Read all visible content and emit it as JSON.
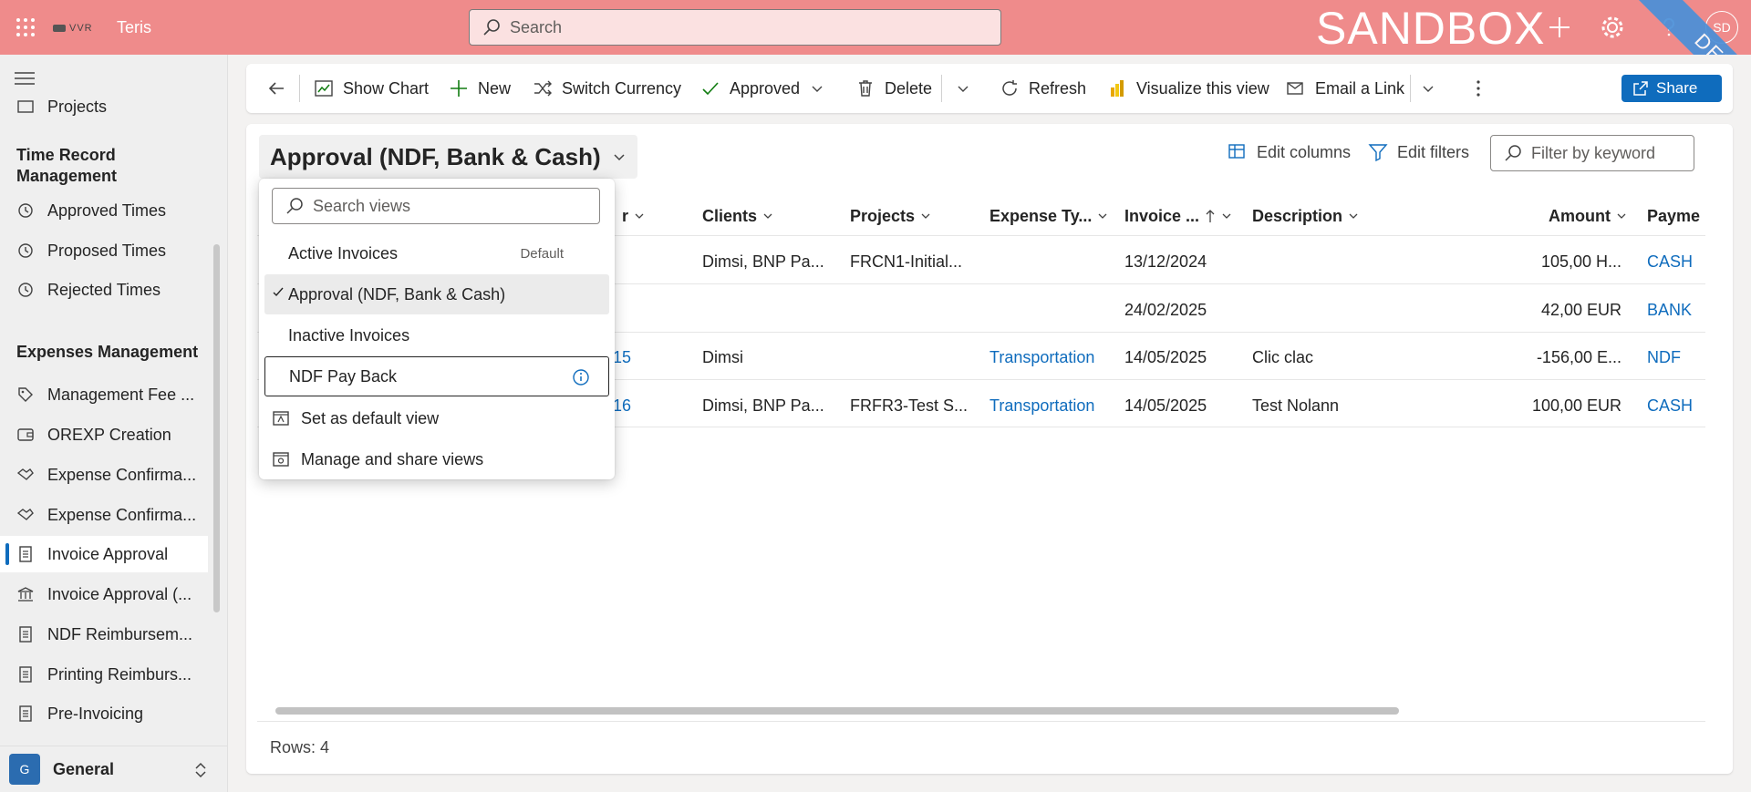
{
  "topbar": {
    "logo_text": "VVR",
    "app_name": "Teris",
    "search_placeholder": "Search",
    "env_label": "SANDBOX",
    "ribbon_label": "DEV",
    "user_initials": "SD"
  },
  "sidebar": {
    "top_item": "Projects",
    "group_time": "Time Record Management",
    "time_items": [
      "Approved Times",
      "Proposed Times",
      "Rejected Times"
    ],
    "group_expenses": "Expenses Management",
    "expense_items": [
      "Management Fee ...",
      "OREXP Creation",
      "Expense Confirma...",
      "Expense Confirma...",
      "Invoice Approval",
      "Invoice Approval (...",
      "NDF Reimbursem...",
      "Printing Reimburs...",
      "Pre-Invoicing"
    ],
    "area_badge": "G",
    "area_label": "General"
  },
  "commands": {
    "show_chart": "Show Chart",
    "new": "New",
    "switch_currency": "Switch Currency",
    "approved": "Approved",
    "delete": "Delete",
    "refresh": "Refresh",
    "visualize": "Visualize this view",
    "email_link": "Email a Link",
    "share": "Share"
  },
  "view": {
    "title": "Approval (NDF, Bank & Cash)",
    "edit_columns": "Edit columns",
    "edit_filters": "Edit filters",
    "filter_placeholder": "Filter by keyword"
  },
  "grid": {
    "columns": [
      "r",
      "Clients",
      "Projects",
      "Expense Ty...",
      "Invoice ...",
      "Description",
      "Amount",
      "Payme"
    ],
    "rows": [
      {
        "id": "",
        "client": "Dimsi, BNP Pa...",
        "project": "FRCN1-Initial...",
        "type": "",
        "date": "13/12/2024",
        "desc": "",
        "amount": "105,00 H...",
        "pay": "CASH"
      },
      {
        "id": "",
        "client": "",
        "project": "",
        "type": "",
        "date": "24/02/2025",
        "desc": "",
        "amount": "42,00 EUR",
        "pay": "BANK"
      },
      {
        "id": "15",
        "client": "Dimsi",
        "project": "",
        "type": "Transportation",
        "date": "14/05/2025",
        "desc": "Clic clac",
        "amount": "-156,00 E...",
        "pay": "NDF"
      },
      {
        "id": "16",
        "client": "Dimsi, BNP Pa...",
        "project": "FRFR3-Test S...",
        "type": "Transportation",
        "date": "14/05/2025",
        "desc": "Test Nolann",
        "amount": "100,00 EUR",
        "pay": "CASH"
      }
    ],
    "rows_label": "Rows: 4"
  },
  "dropdown": {
    "search_placeholder": "Search views",
    "items": [
      {
        "label": "Active Invoices",
        "tag": "Default"
      },
      {
        "label": "Approval (NDF, Bank & Cash)"
      },
      {
        "label": "Inactive Invoices"
      },
      {
        "label": "NDF Pay Back"
      }
    ],
    "set_default": "Set as default view",
    "manage": "Manage and share views"
  },
  "colors": {
    "topbar": "#ef8b8b",
    "accent": "#0f6cbd",
    "ribbon": "#4a90d9"
  }
}
